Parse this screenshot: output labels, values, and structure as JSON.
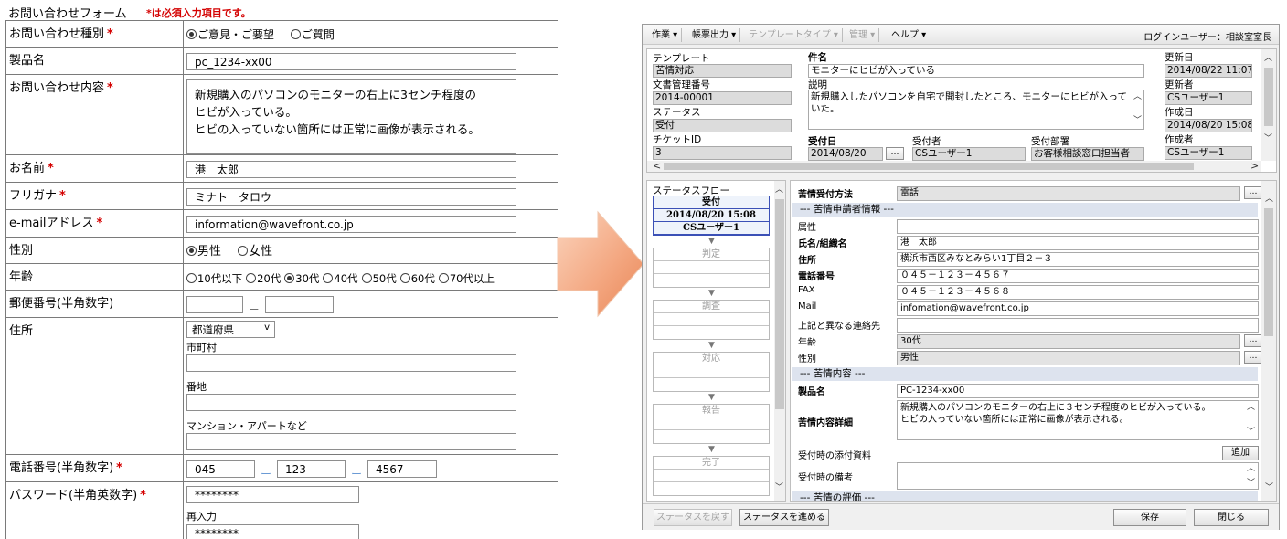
{
  "form": {
    "title": "お問い合わせフォーム",
    "note": "*は必須入力項目です。",
    "req_mark": "*",
    "inquiry_type": {
      "label": "お問い合わせ種別",
      "options": [
        "ご意見・ご要望",
        "ご質問"
      ],
      "selected": "ご意見・ご要望"
    },
    "product": {
      "label": "製品名",
      "value": "pc_1234-xx00"
    },
    "content": {
      "label": "お問い合わせ内容",
      "lines": [
        "新規購入のパソコンのモニターの右上に3センチ程度の",
        "ヒビが入っている。",
        "ヒビの入っていない箇所には正常に画像が表示される。"
      ]
    },
    "name": {
      "label": "お名前",
      "value": "港　太郎"
    },
    "furigana": {
      "label": "フリガナ",
      "value": "ミナト　タロウ"
    },
    "email": {
      "label": "e-mailアドレス",
      "value": "information@wavefront.co.jp"
    },
    "gender": {
      "label": "性別",
      "options": [
        "男性",
        "女性"
      ],
      "selected": "男性"
    },
    "age": {
      "label": "年齢",
      "options": [
        "10代以下",
        "20代",
        "30代",
        "40代",
        "50代",
        "60代",
        "70代以上"
      ],
      "selected": "30代"
    },
    "postal": {
      "label": "郵便番号(半角数字)",
      "sep": "－"
    },
    "address": {
      "label": "住所",
      "pref_select": "都道府県",
      "city": "市町村",
      "banchi": "番地",
      "mansion": "マンション・アパートなど"
    },
    "phone": {
      "label": "電話番号(半角数字)",
      "parts": [
        "045",
        "123",
        "4567"
      ],
      "sep": "ー"
    },
    "password": {
      "label": "パスワード(半角英数字)",
      "value": "********",
      "reenter_label": "再入力",
      "reenter_value": "********"
    }
  },
  "app": {
    "menus": [
      {
        "label": "作業 ▾",
        "enabled": true
      },
      {
        "label": "帳票出力 ▾",
        "enabled": true
      },
      {
        "label": "テンプレートタイプ ▾",
        "enabled": false
      },
      {
        "label": "管理 ▾",
        "enabled": false
      },
      {
        "label": "ヘルプ ▾",
        "enabled": true
      }
    ],
    "login": "ログインユーザー：相談室室長",
    "header": {
      "template_label": "テンプレート",
      "template_value": "苦情対応",
      "docno_label": "文書管理番号",
      "docno_value": "2014-00001",
      "status_label": "ステータス",
      "status_value": "受付",
      "ticket_label": "チケットID",
      "ticket_value": "3",
      "subject_label": "件名",
      "subject_value": "モニターにヒビが入っている",
      "desc_label": "説明",
      "desc_value": "新規購入したパソコンを自宅で開封したところ、モニターにヒビが入っていた。",
      "updated_label": "更新日",
      "updated_value": "2014/08/22 11:07",
      "updater_label": "更新者",
      "updater_value": "CSユーザー1",
      "created_label": "作成日",
      "created_value": "2014/08/20 15:08",
      "creator_label": "作成者",
      "creator_value": "CSユーザー1",
      "recv_date_label": "受付日",
      "recv_date_value": "2014/08/20",
      "receiver_label": "受付者",
      "receiver_value": "CSユーザー1",
      "dept_label": "受付部署",
      "dept_value": "お客様相談窓口担当者",
      "dots": "…"
    },
    "flow": {
      "title": "ステータスフロー",
      "active": [
        "受付",
        "2014/08/20 15:08",
        "CSユーザー1"
      ],
      "steps": [
        "判定",
        "調査",
        "対応",
        "報告",
        "完了"
      ],
      "arrow": "▼"
    },
    "detail": {
      "method_label": "苦情受付方法",
      "method_value": "電話",
      "sec1": "--- 苦情申請者情報 ---",
      "attr_label": "属性",
      "attr_value": "",
      "name_label": "氏名/組織名",
      "name_value": "港　太郎",
      "addr_label": "住所",
      "addr_value": "横浜市西区みなとみらい1丁目２－３",
      "tel_label": "電話番号",
      "tel_value": "０４５－１２３－４５６７",
      "fax_label": "FAX",
      "fax_value": "０４５－１２３－４５６８",
      "mail_label": "Mail",
      "mail_value": "infomation@wavefront.co.jp",
      "other_label": "上記と異なる連絡先",
      "other_value": "",
      "age_label": "年齢",
      "age_value": "30代",
      "gender_label": "性別",
      "gender_value": "男性",
      "sec2": "--- 苦情内容 ---",
      "product_label": "製品名",
      "product_value": "PC-1234-xx00",
      "content_label": "苦情内容詳細",
      "content_lines": [
        "新規購入のパソコンのモニターの右上に３センチ程度のヒビが入っている。",
        "ヒビの入っていない箇所には正常に画像が表示される。"
      ],
      "attach_label": "受付時の添付資料",
      "attach_button": "追加",
      "memo_label": "受付時の備考",
      "sec3": "--- 苦情の評価 ---",
      "dots": "…"
    },
    "buttons": {
      "back": "ステータスを戻す",
      "advance": "ステータスを進める",
      "save": "保存",
      "close": "閉じる"
    }
  }
}
